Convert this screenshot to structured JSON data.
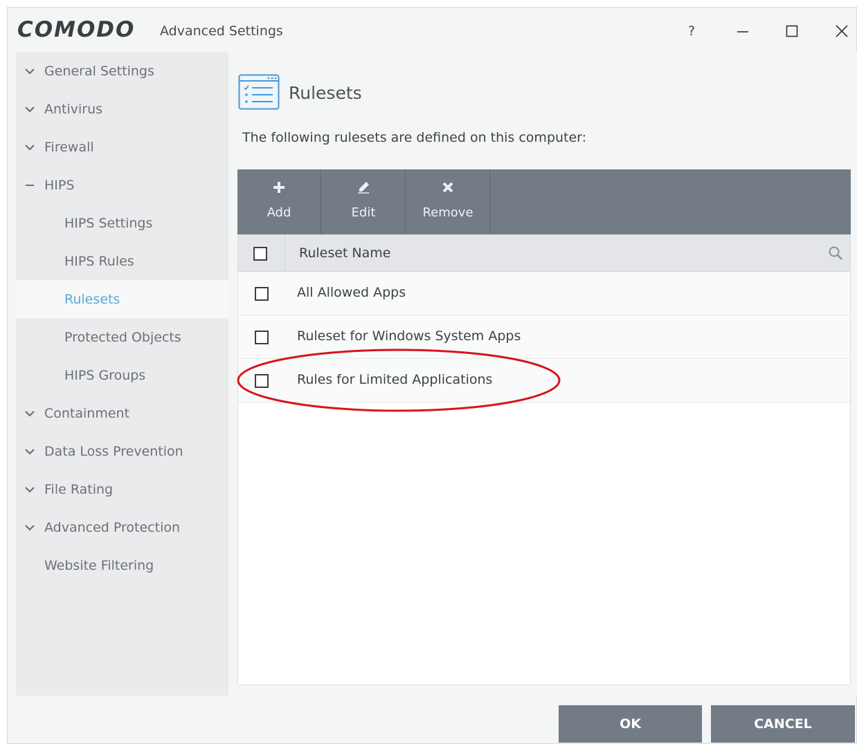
{
  "window": {
    "logo": "COMODO",
    "title": "Advanced Settings",
    "controls": {
      "help": "?",
      "minimize": "minimize-icon",
      "maximize": "maximize-icon",
      "close": "close-icon"
    }
  },
  "sidebar": {
    "items": [
      {
        "label": "General Settings",
        "icon": "chevron-down-icon"
      },
      {
        "label": "Antivirus",
        "icon": "chevron-down-icon"
      },
      {
        "label": "Firewall",
        "icon": "chevron-down-icon"
      },
      {
        "label": "HIPS",
        "icon": "minus-icon"
      },
      {
        "label": "HIPS Settings"
      },
      {
        "label": "HIPS Rules"
      },
      {
        "label": "Rulesets",
        "active": true
      },
      {
        "label": "Protected Objects"
      },
      {
        "label": "HIPS Groups"
      },
      {
        "label": "Containment",
        "icon": "chevron-down-icon"
      },
      {
        "label": "Data Loss Prevention",
        "icon": "chevron-down-icon"
      },
      {
        "label": "File Rating",
        "icon": "chevron-down-icon"
      },
      {
        "label": "Advanced Protection",
        "icon": "chevron-down-icon"
      },
      {
        "label": "Website Filtering"
      }
    ],
    "active_color": "#5aa8d8"
  },
  "main": {
    "title": "Rulesets",
    "description": "The following rulesets are defined on this computer:",
    "toolbar": {
      "add": "Add",
      "edit": "Edit",
      "remove": "Remove"
    },
    "table": {
      "header": "Ruleset Name",
      "rows": [
        "All Allowed Apps",
        "Ruleset for Windows System Apps",
        "Rules for Limited Applications"
      ]
    },
    "highlight_color": "#d9141b"
  },
  "footer": {
    "ok": "OK",
    "cancel": "CANCEL"
  },
  "colors": {
    "toolbar": "#737b87",
    "sidebar": "#eaebec"
  }
}
